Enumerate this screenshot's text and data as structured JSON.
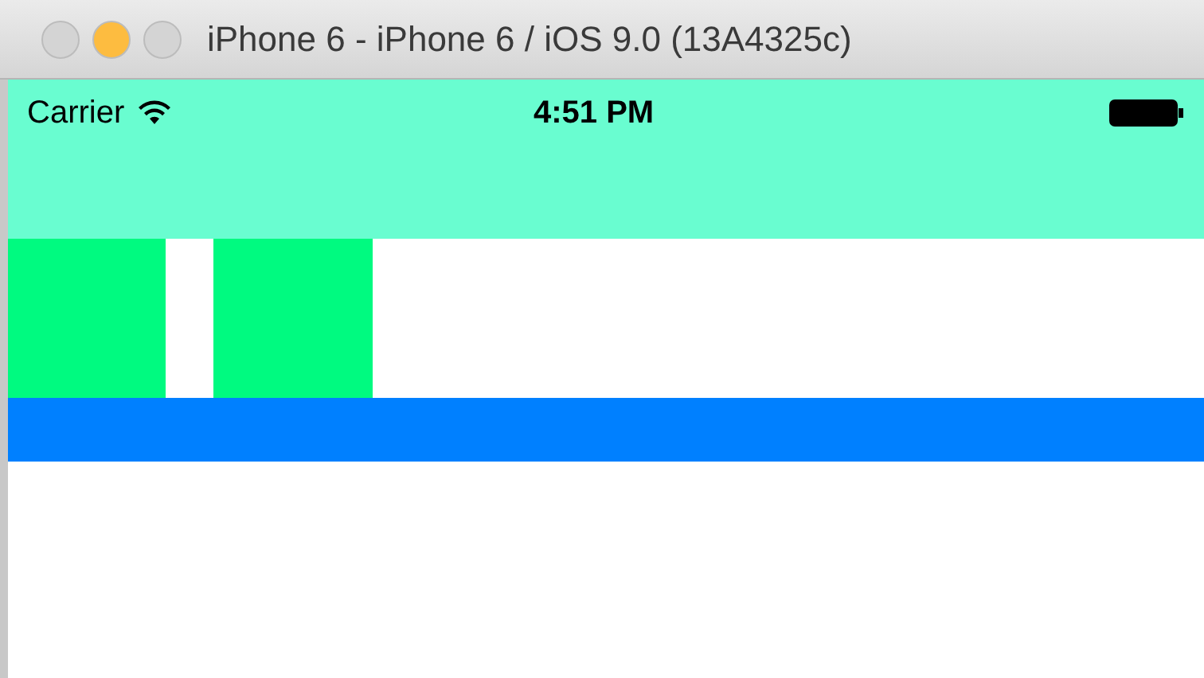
{
  "window": {
    "title": "iPhone 6 - iPhone 6 / iOS 9.0 (13A4325c)",
    "controls": [
      {
        "color": "#d4d4d4"
      },
      {
        "color": "#fdbc40"
      },
      {
        "color": "#d4d4d4"
      }
    ]
  },
  "status_bar": {
    "carrier": "Carrier",
    "time": "4:51 PM"
  }
}
